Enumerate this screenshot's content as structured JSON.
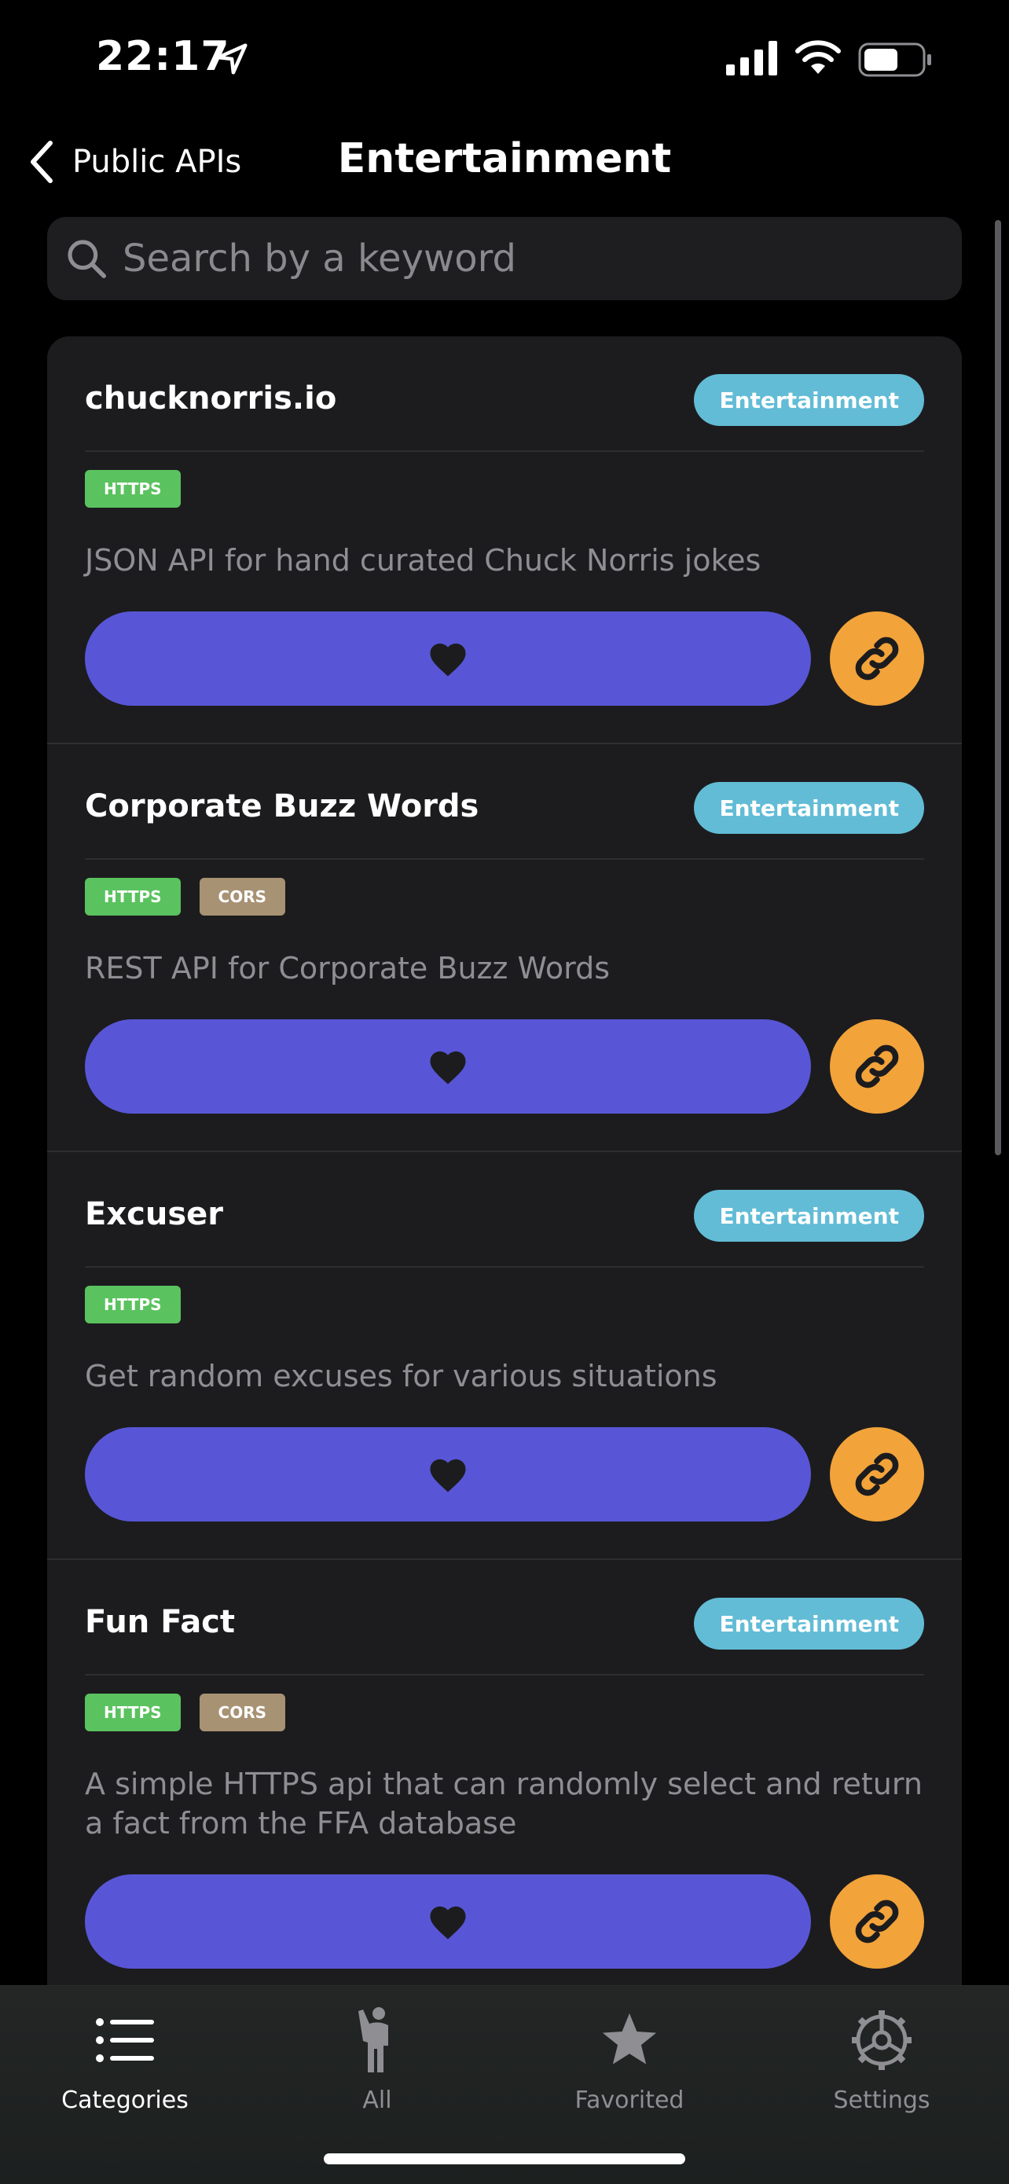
{
  "status": {
    "time": "22:17"
  },
  "nav": {
    "back_label": "Public APIs",
    "title": "Entertainment"
  },
  "search": {
    "placeholder": "Search by a keyword",
    "value": ""
  },
  "items": [
    {
      "title": "chucknorris.io",
      "category": "Entertainment",
      "tags": [
        "HTTPS"
      ],
      "description": "JSON API for hand curated Chuck Norris jokes"
    },
    {
      "title": "Corporate Buzz Words",
      "category": "Entertainment",
      "tags": [
        "HTTPS",
        "CORS"
      ],
      "description": "REST API for Corporate Buzz Words"
    },
    {
      "title": "Excuser",
      "category": "Entertainment",
      "tags": [
        "HTTPS"
      ],
      "description": "Get random excuses for various situations"
    },
    {
      "title": "Fun Fact",
      "category": "Entertainment",
      "tags": [
        "HTTPS",
        "CORS"
      ],
      "description": "A simple HTTPS api that can randomly select and return a fact from the FFA database"
    }
  ],
  "tabs": [
    {
      "label": "Categories",
      "icon": "list-icon",
      "active": true
    },
    {
      "label": "All",
      "icon": "person-icon",
      "active": false
    },
    {
      "label": "Favorited",
      "icon": "star-icon",
      "active": false
    },
    {
      "label": "Settings",
      "icon": "gear-icon",
      "active": false
    }
  ],
  "colors": {
    "accent_purple": "#5856d6",
    "link_orange": "#f2a33a",
    "category_blue": "#62bcd6",
    "https_green": "#5ac25e",
    "cors_tan": "#a89274"
  }
}
